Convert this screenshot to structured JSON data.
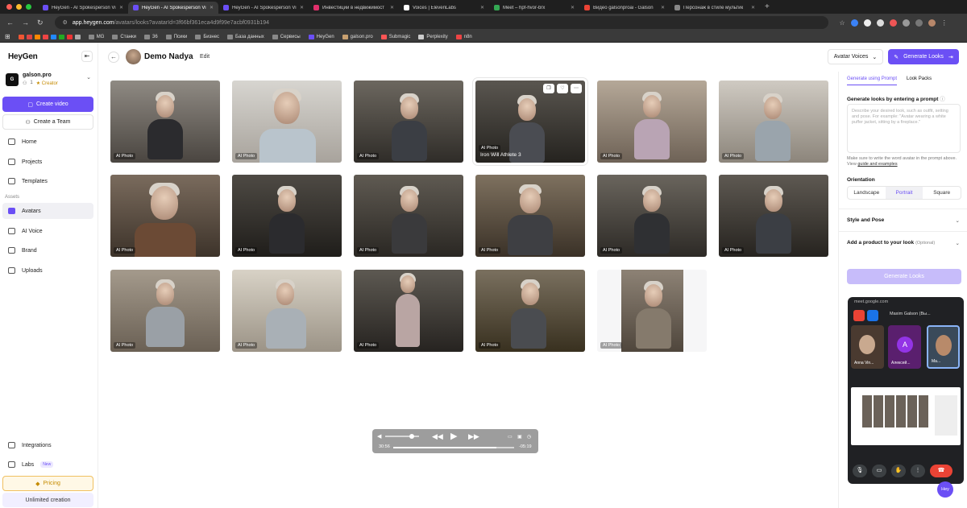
{
  "browser": {
    "tabs": [
      {
        "title": "HeyGen - AI Spokesperson Vi",
        "color": "#6b4ff5"
      },
      {
        "title": "HeyGen - AI Spokesperson Vi",
        "color": "#6b4ff5"
      },
      {
        "title": "HeyGen - AI Spokesperson Vi",
        "color": "#6b4ff5"
      },
      {
        "title": "Инвестиции в недвижимост",
        "color": "#e1306c"
      },
      {
        "title": "Voices | ElevenLabs",
        "color": "#ffffff"
      },
      {
        "title": "Meet – hpf-hvor-brx",
        "color": "#34a853"
      },
      {
        "title": "Видео galsonproai - Galson",
        "color": "#ea4335"
      },
      {
        "title": "Персонаж в стиле мультик",
        "color": "#888888"
      }
    ],
    "url_domain": "app.heygen.com",
    "url_path": "/avatars/looks?avatarId=3f66bf361eca4d9f99e7acbf0931b194",
    "bookmarks": [
      "MG",
      "Станки",
      "36",
      "Псики",
      "Бизнес",
      "База данных",
      "Сервисы",
      "HeyGen",
      "galson.pro",
      "Submagic",
      "Perplexity",
      "n8n"
    ]
  },
  "sidebar": {
    "logo": "HeyGen",
    "workspace_name": "galson.pro",
    "workspace_count": "1",
    "workspace_plan": "Creator",
    "create_video": "Create video",
    "create_team": "Create a Team",
    "nav": [
      {
        "label": "Home"
      },
      {
        "label": "Projects"
      },
      {
        "label": "Templates"
      }
    ],
    "assets_label": "Assets",
    "assets": [
      {
        "label": "Avatars"
      },
      {
        "label": "AI Voice"
      },
      {
        "label": "Brand"
      },
      {
        "label": "Uploads"
      }
    ],
    "integrations": "Integrations",
    "labs": "Labs",
    "labs_badge": "New",
    "pricing": "Pricing",
    "unlimited": "Unlimited creation"
  },
  "header": {
    "title": "Demo Nadya",
    "edit": "Edit",
    "voices": "Avatar Voices",
    "generate": "Generate Looks"
  },
  "grid": {
    "photo_label": "AI Photo",
    "selected_caption": "Iron Will Athlete 3"
  },
  "panel": {
    "tab_prompt": "Generate using Prompt",
    "tab_packs": "Look Packs",
    "prompt_heading": "Generate looks by entering a prompt",
    "prompt_placeholder": "Describe your desired look, such as outfit, setting and pose. For example: \"Avatar wearing a white puffer jacket, sitting by a fireplace.\"",
    "help_text": "Make sure to write the word avatar in the prompt above. View",
    "help_link": "guide and examples",
    "orientation": "Orientation",
    "orient_options": [
      "Landscape",
      "Portrait",
      "Square"
    ],
    "orient_selected": "Portrait",
    "style_pose": "Style and Pose",
    "add_product": "Add a product to your look",
    "add_product_optional": "(Optional)",
    "generate_btn": "Generate Looks"
  },
  "meet": {
    "url": "meet.google.com",
    "speaker": "Maxim Galson (Вы...",
    "tiles": [
      "Anna Vin...",
      "Алексей...",
      "Ma..."
    ],
    "tile_initial": "A"
  },
  "player": {
    "elapsed": "30:56",
    "remaining": "-05:19"
  },
  "hey_button": "Hey",
  "colors": {
    "accent": "#6b4ff5",
    "creator": "#c58b00"
  }
}
